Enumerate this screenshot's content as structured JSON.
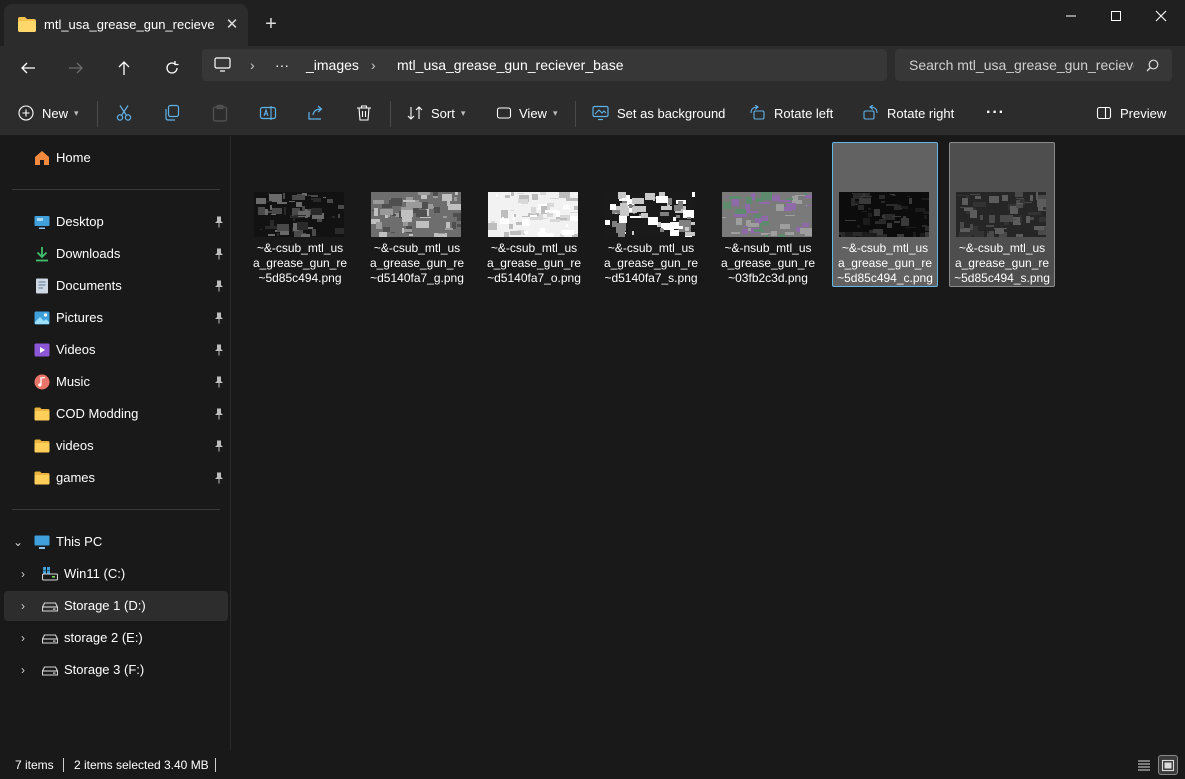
{
  "window": {
    "tab_title": "mtl_usa_grease_gun_reciever_",
    "tab_close": "✕",
    "new_tab": "+"
  },
  "address": {
    "more": "···",
    "crumbs": [
      "_images",
      "mtl_usa_grease_gun_reciever_base"
    ],
    "search_placeholder": "Search mtl_usa_grease_gun_recieve"
  },
  "commands": {
    "new": "New",
    "sort": "Sort",
    "view": "View",
    "set_background": "Set as background",
    "rotate_left": "Rotate left",
    "rotate_right": "Rotate right",
    "more": "···",
    "preview": "Preview"
  },
  "sidebar": {
    "home": "Home",
    "quick_access": [
      {
        "label": "Desktop",
        "icon": "desktop-icon"
      },
      {
        "label": "Downloads",
        "icon": "download-icon"
      },
      {
        "label": "Documents",
        "icon": "document-icon"
      },
      {
        "label": "Pictures",
        "icon": "pictures-icon"
      },
      {
        "label": "Videos",
        "icon": "videos-icon"
      },
      {
        "label": "Music",
        "icon": "music-icon"
      },
      {
        "label": "COD Modding",
        "icon": "folder-icon"
      },
      {
        "label": "videos",
        "icon": "folder-icon"
      },
      {
        "label": "games",
        "icon": "folder-icon"
      }
    ],
    "this_pc": "This PC",
    "drives": [
      {
        "label": "Win11 (C:)",
        "icon": "windows-drive-icon"
      },
      {
        "label": "Storage 1 (D:)",
        "icon": "drive-icon"
      },
      {
        "label": "storage 2 (E:)",
        "icon": "drive-icon"
      },
      {
        "label": "Storage 3 (F:)",
        "icon": "drive-icon"
      }
    ],
    "selected_drive": 1
  },
  "files": [
    {
      "lines": [
        "~&-csub_mtl_us",
        "a_grease_gun_re",
        "~5d85c494.png"
      ],
      "selected": false
    },
    {
      "lines": [
        "~&-csub_mtl_us",
        "a_grease_gun_re",
        "~d5140fa7_g.png"
      ],
      "selected": false
    },
    {
      "lines": [
        "~&-csub_mtl_us",
        "a_grease_gun_re",
        "~d5140fa7_o.png"
      ],
      "selected": false
    },
    {
      "lines": [
        "~&-csub_mtl_us",
        "a_grease_gun_re",
        "~d5140fa7_s.png"
      ],
      "selected": false
    },
    {
      "lines": [
        "~&-nsub_mtl_us",
        "a_grease_gun_re",
        "~03fb2c3d.png"
      ],
      "selected": false
    },
    {
      "lines": [
        "~&-csub_mtl_us",
        "a_grease_gun_re",
        "~5d85c494_c.png"
      ],
      "selected": true
    },
    {
      "lines": [
        "~&-csub_mtl_us",
        "a_grease_gun_re",
        "~5d85c494_s.png"
      ],
      "selected": true
    }
  ],
  "status": {
    "item_count": "7 items",
    "selection": "2 items selected",
    "size": "3.40 MB"
  },
  "colors": {
    "accent": "#62b6e3",
    "folder": "#f2c14e",
    "background": "#191919",
    "toolbar": "#2c2c2c"
  }
}
